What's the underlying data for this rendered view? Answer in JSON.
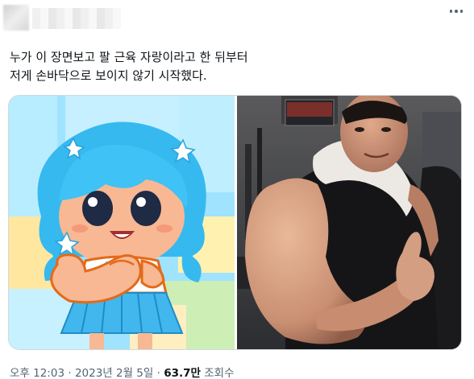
{
  "tweet": {
    "text_lines": [
      "누가 이 장면보고 팔 근육 자랑이라고 한 뒤부터",
      "저게 손바닥으로 보이지 않기 시작했다."
    ],
    "meta": {
      "time": "오후 12:03",
      "separator": "·",
      "date": "2023년 2월 5일",
      "views_count": "63.7만",
      "views_label": "조회수"
    }
  },
  "colors": {
    "text": "#0f1419",
    "secondary": "#536471",
    "border": "#cfd9de"
  },
  "icons": [
    "more-icon"
  ]
}
